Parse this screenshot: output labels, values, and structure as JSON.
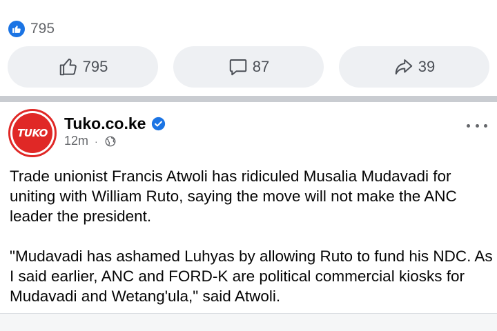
{
  "reactions": {
    "count": "795",
    "icon": "thumbs-up-icon",
    "badge_color": "#1b74e4"
  },
  "actions": {
    "like_count": "795",
    "comment_count": "87",
    "share_count": "39"
  },
  "post": {
    "page_name": "Tuko.co.ke",
    "avatar_text": "TUKO",
    "brand_color": "#e02826",
    "time": "12m",
    "separator": "·",
    "privacy_icon": "globe-icon",
    "verified_icon": "verified-badge-icon",
    "paragraphs": [
      "Trade unionist Francis Atwoli has ridiculed Musalia Mudavadi for uniting with William Ruto, saying the move will not make the ANC leader the president.",
      "\"Mudavadi has ashamed Luhyas by allowing Ruto to fund his NDC. As I said earlier, ANC and FORD-K are political commercial kiosks for Mudavadi and Wetang'ula,\" said Atwoli."
    ]
  }
}
